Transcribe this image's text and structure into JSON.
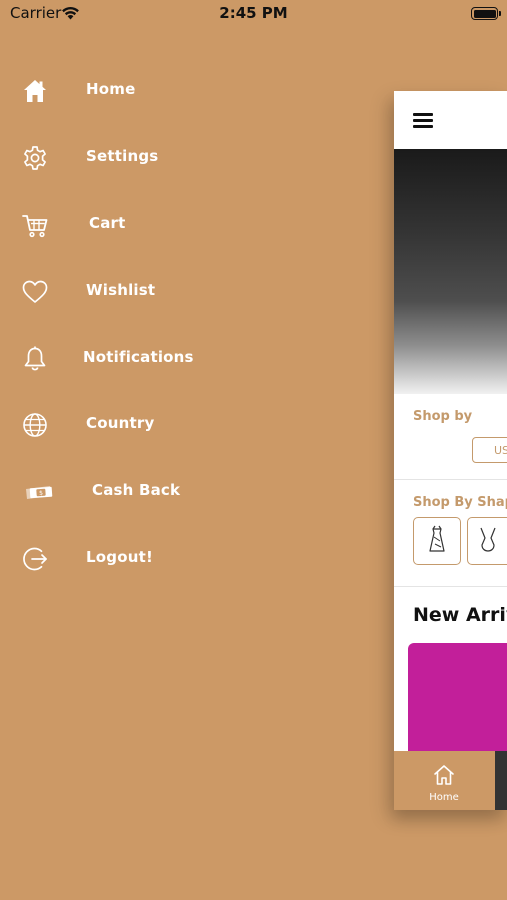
{
  "status_bar": {
    "carrier": "Carrier",
    "time": "2:45 PM"
  },
  "menu": {
    "items": [
      {
        "label": "Home",
        "icon": "home-icon"
      },
      {
        "label": "Settings",
        "icon": "gear-icon"
      },
      {
        "label": "Cart",
        "icon": "cart-icon"
      },
      {
        "label": "Wishlist",
        "icon": "heart-icon"
      },
      {
        "label": "Notifications",
        "icon": "bell-icon"
      },
      {
        "label": "Country",
        "icon": "globe-icon"
      },
      {
        "label": "Cash Back",
        "icon": "cash-icon"
      },
      {
        "label": "Logout!",
        "icon": "logout-icon"
      }
    ]
  },
  "app_preview": {
    "shop_by_label": "Shop by",
    "currency_chip": "US",
    "shop_by_shape_label": "Shop By Shap",
    "new_arrivals_label": "New Arriv",
    "tab_home_label": "Home"
  },
  "colors": {
    "accent": "#CC9966",
    "label_accent": "#C49A6C",
    "product_magenta": "#C21F9A"
  }
}
